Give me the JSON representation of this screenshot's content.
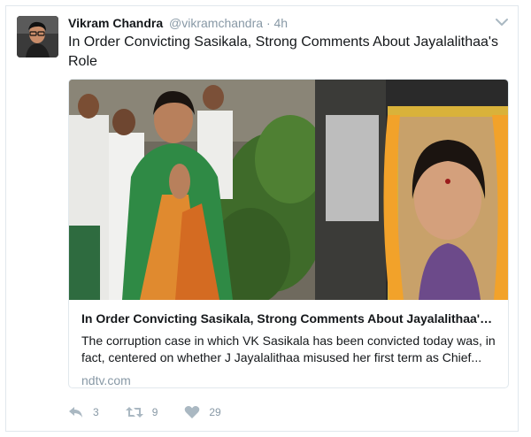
{
  "tweet": {
    "author": {
      "display_name": "Vikram Chandra",
      "handle": "@vikramchandra",
      "separator": "·",
      "time": "4h",
      "avatar_icon": "profile-photo"
    },
    "text": "In Order Convicting Sasikala, Strong Comments About Jayalalithaa's Role",
    "card": {
      "title": "In Order Convicting Sasikala, Strong Comments About Jayalalithaa's Role",
      "description": "The corruption case in which VK Sasikala has been convicted today was, in fact, centered on whether J Jayalalithaa misused her first term as Chief...",
      "domain": "ndtv.com"
    },
    "actions": {
      "reply": {
        "icon": "reply-icon",
        "count": "3"
      },
      "retweet": {
        "icon": "retweet-icon",
        "count": "9"
      },
      "like": {
        "icon": "heart-icon",
        "count": "29"
      }
    },
    "colors": {
      "text": "#14171a",
      "muted": "#8899a6",
      "icon": "#aab8c2",
      "border": "#e1e8ed"
    }
  }
}
